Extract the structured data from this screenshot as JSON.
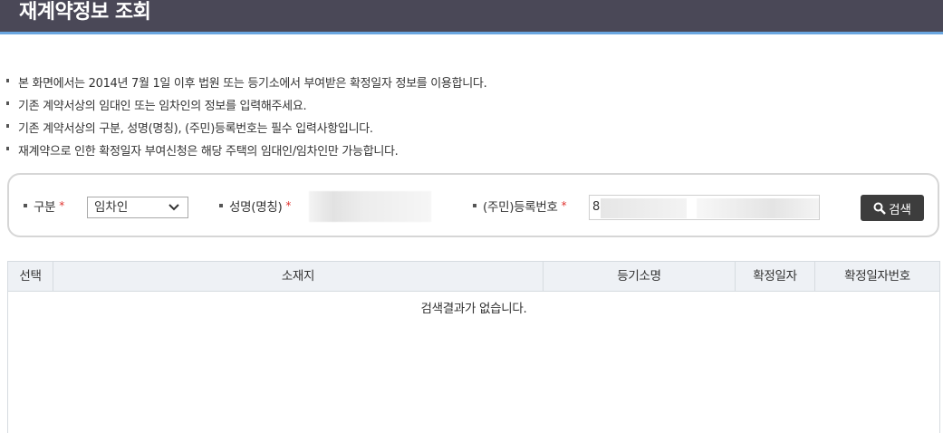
{
  "header": {
    "title": "재계약정보 조회"
  },
  "notices": [
    "본 화면에서는 2014년 7월 1일 이후 법원 또는 등기소에서 부여받은 확정일자 정보를 이용합니다.",
    "기존 계약서상의 임대인 또는 임차인의 정보를 입력해주세요.",
    "기존 계약서상의 구분, 성명(명칭), (주민)등록번호는 필수 입력사항입니다.",
    "재계약으로 인한 확정일자 부여신청은 해당 주택의 임대인/임차인만 가능합니다."
  ],
  "search": {
    "type_label": "구분",
    "type_value": "임차인",
    "name_label": "성명(명칭)",
    "reg_label": "(주민)등록번호",
    "reg_value_prefix": "8",
    "required_mark": "*",
    "button_label": "검색"
  },
  "table": {
    "columns": [
      "선택",
      "소재지",
      "등기소명",
      "확정일자",
      "확정일자번호"
    ],
    "empty_message": "검색결과가 없습니다."
  },
  "colors": {
    "title_bar": "#4a4857",
    "title_underline": "#6aa6e0",
    "required": "#e0332f",
    "button": "#3d3d3d",
    "table_header": "#eef1f5"
  }
}
